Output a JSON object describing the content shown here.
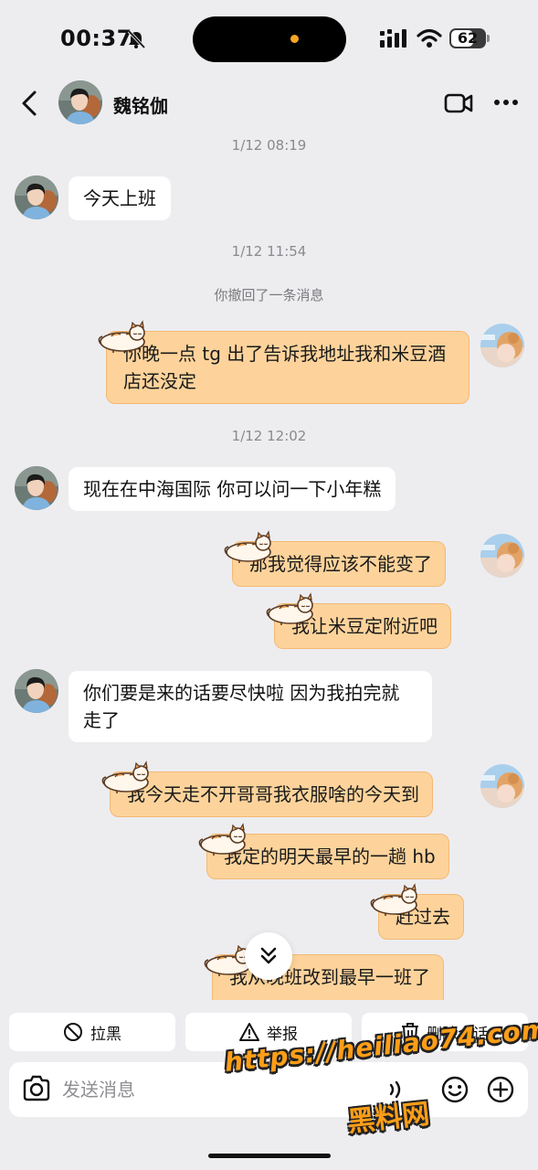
{
  "status_bar": {
    "time": "00:37",
    "battery": "62",
    "icons": [
      "bell-slash-icon",
      "cellular-signal-icon",
      "wifi-icon",
      "battery-icon"
    ]
  },
  "header": {
    "contact_name": "魏铭伽",
    "icons": [
      "back-chevron-icon",
      "video-call-icon",
      "more-dots-icon"
    ]
  },
  "chat": {
    "timestamps": [
      "1/12 08:19",
      "1/12 11:54",
      "1/12 12:02"
    ],
    "recall_notice": "你撤回了一条消息",
    "messages": [
      {
        "side": "in",
        "text": "今天上班"
      },
      {
        "side": "out",
        "text": "你晚一点 tg 出了告诉我地址我和米豆酒店还没定"
      },
      {
        "side": "in",
        "text": "现在在中海国际 你可以问一下小年糕"
      },
      {
        "side": "out",
        "text": "那我觉得应该不能变了"
      },
      {
        "side": "out",
        "text": "我让米豆定附近吧"
      },
      {
        "side": "in",
        "text": "你们要是来的话要尽快啦 因为我拍完就走了"
      },
      {
        "side": "out",
        "text": "我今天走不开哥哥我衣服啥的今天到"
      },
      {
        "side": "out",
        "text": "我定的明天最早的一趟 hb"
      },
      {
        "side": "out",
        "text": "赶过去"
      },
      {
        "side": "out",
        "text": "我从晚班改到最早一班了"
      }
    ]
  },
  "actions": {
    "block": "拉黑",
    "report": "举报",
    "delete_chat": "删除会话"
  },
  "input": {
    "placeholder": "发送消息"
  },
  "watermark": {
    "url": "https://heiliao74.com",
    "name": "黑料网"
  },
  "colors": {
    "background": "#ededf0",
    "outgoing_bubble": "#fdd39b",
    "outgoing_border": "#f2b974",
    "incoming_bubble": "#ffffff",
    "watermark": "#ff9e17"
  }
}
